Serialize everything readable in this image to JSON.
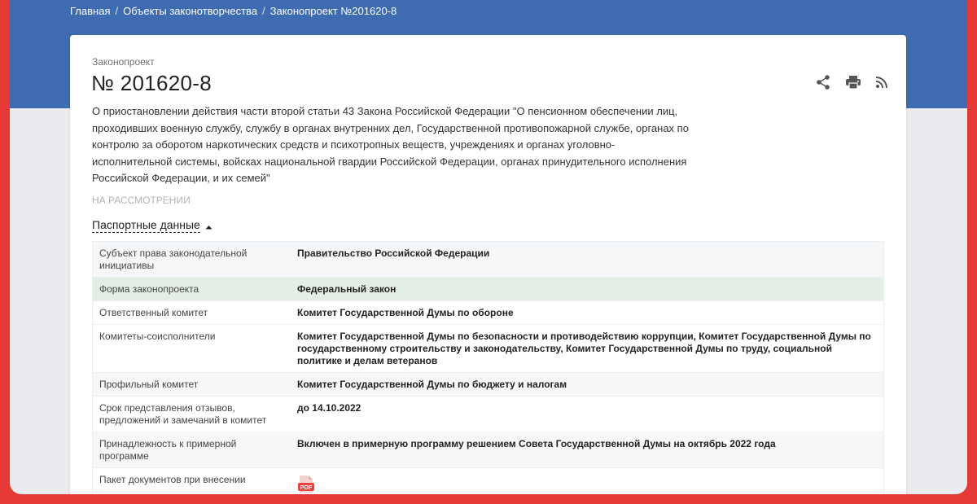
{
  "breadcrumb": {
    "items": [
      "Главная",
      "Объекты законотворчества",
      "Законопроект №201620-8"
    ],
    "separator": "/"
  },
  "bill": {
    "kind": "Законопроект",
    "number": "№ 201620-8",
    "description": "О приостановлении действия части второй статьи 43 Закона Российской Федерации \"О пенсионном обеспечении лиц, проходивших военную службу, службу в органах внутренних дел, Государственной противопожарной службе, органах по контролю за оборотом наркотических средств и психотропных веществ, учреждениях и органах уголовно-исполнительной системы, войсках национальной гвардии Российской Федерации, органах принудительного исполнения Российской Федерации, и их семей\"",
    "status": "НА РАССМОТРЕНИИ"
  },
  "actions": {
    "share_icon": "share-icon",
    "print_icon": "print-icon",
    "rss_icon": "rss-icon"
  },
  "passport": {
    "toggle_label": "Паспортные данные",
    "rows": [
      {
        "key": "Субъект права законодательной инициативы",
        "value": "Правительство Российской Федерации"
      },
      {
        "key": "Форма законопроекта",
        "value": "Федеральный закон"
      },
      {
        "key": "Ответственный комитет",
        "value": "Комитет Государственной Думы по обороне"
      },
      {
        "key": "Комитеты-соисполнители",
        "value": "Комитет Государственной Думы по безопасности и противодействию коррупции, Комитет Государственной Думы по государственному строительству и законодательству, Комитет Государственной Думы по труду, социальной политике и делам ветеранов"
      },
      {
        "key": "Профильный комитет",
        "value": "Комитет Государственной Думы по бюджету и налогам"
      },
      {
        "key": "Срок представления отзывов, предложений и замечаний в комитет",
        "value": "до 14.10.2022"
      },
      {
        "key": "Принадлежность к примерной программе",
        "value": "Включен в примерную программу решением Совета Государственной Думы на октябрь 2022 года"
      },
      {
        "key": "Пакет документов при внесении",
        "value": "",
        "icon": "pdf-icon",
        "icon_text": "PDF"
      }
    ]
  },
  "colors": {
    "header_blue": "#3f6bb0",
    "border_red": "#e53935",
    "highlight_row": "#e3efe6",
    "pdf_red": "#e8453c"
  }
}
